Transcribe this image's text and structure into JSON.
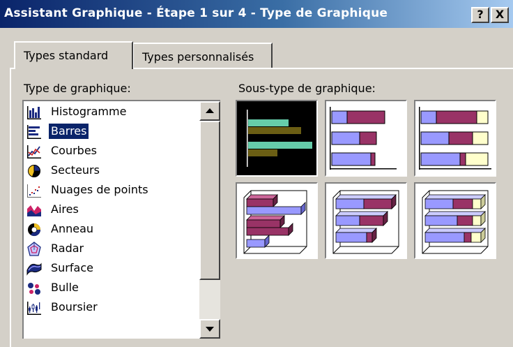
{
  "window": {
    "title": "Assistant Graphique - Étape 1 sur 4 - Type de Graphique",
    "help_label": "?",
    "close_label": "X"
  },
  "tabs": [
    {
      "label": "Types standard",
      "active": true
    },
    {
      "label": "Types personnalisés",
      "active": false
    }
  ],
  "chart_type": {
    "label": "Type de graphique:",
    "items": [
      {
        "label": "Histogramme",
        "icon": "column-chart-icon"
      },
      {
        "label": "Barres",
        "icon": "bar-chart-icon",
        "selected": true
      },
      {
        "label": "Courbes",
        "icon": "line-chart-icon"
      },
      {
        "label": "Secteurs",
        "icon": "pie-chart-icon"
      },
      {
        "label": "Nuages de points",
        "icon": "scatter-chart-icon"
      },
      {
        "label": "Aires",
        "icon": "area-chart-icon"
      },
      {
        "label": "Anneau",
        "icon": "doughnut-chart-icon"
      },
      {
        "label": "Radar",
        "icon": "radar-chart-icon"
      },
      {
        "label": "Surface",
        "icon": "surface-chart-icon"
      },
      {
        "label": "Bulle",
        "icon": "bubble-chart-icon"
      },
      {
        "label": "Boursier",
        "icon": "stock-chart-icon"
      }
    ]
  },
  "subtype": {
    "label": "Sous-type de graphique:",
    "items": [
      {
        "name": "clustered-bar-subtype",
        "selected": true
      },
      {
        "name": "stacked-bar-subtype"
      },
      {
        "name": "100-percent-stacked-bar-subtype"
      },
      {
        "name": "3d-clustered-bar-subtype"
      },
      {
        "name": "3d-stacked-bar-subtype"
      },
      {
        "name": "3d-100-percent-stacked-bar-subtype"
      }
    ]
  },
  "colors": {
    "selection": "#0a246a",
    "series_blue": "#9999ff",
    "series_purple": "#993366",
    "series_cream": "#ffffcc",
    "selected_teal": "#66ccaa",
    "selected_olive": "#6b5e14"
  }
}
